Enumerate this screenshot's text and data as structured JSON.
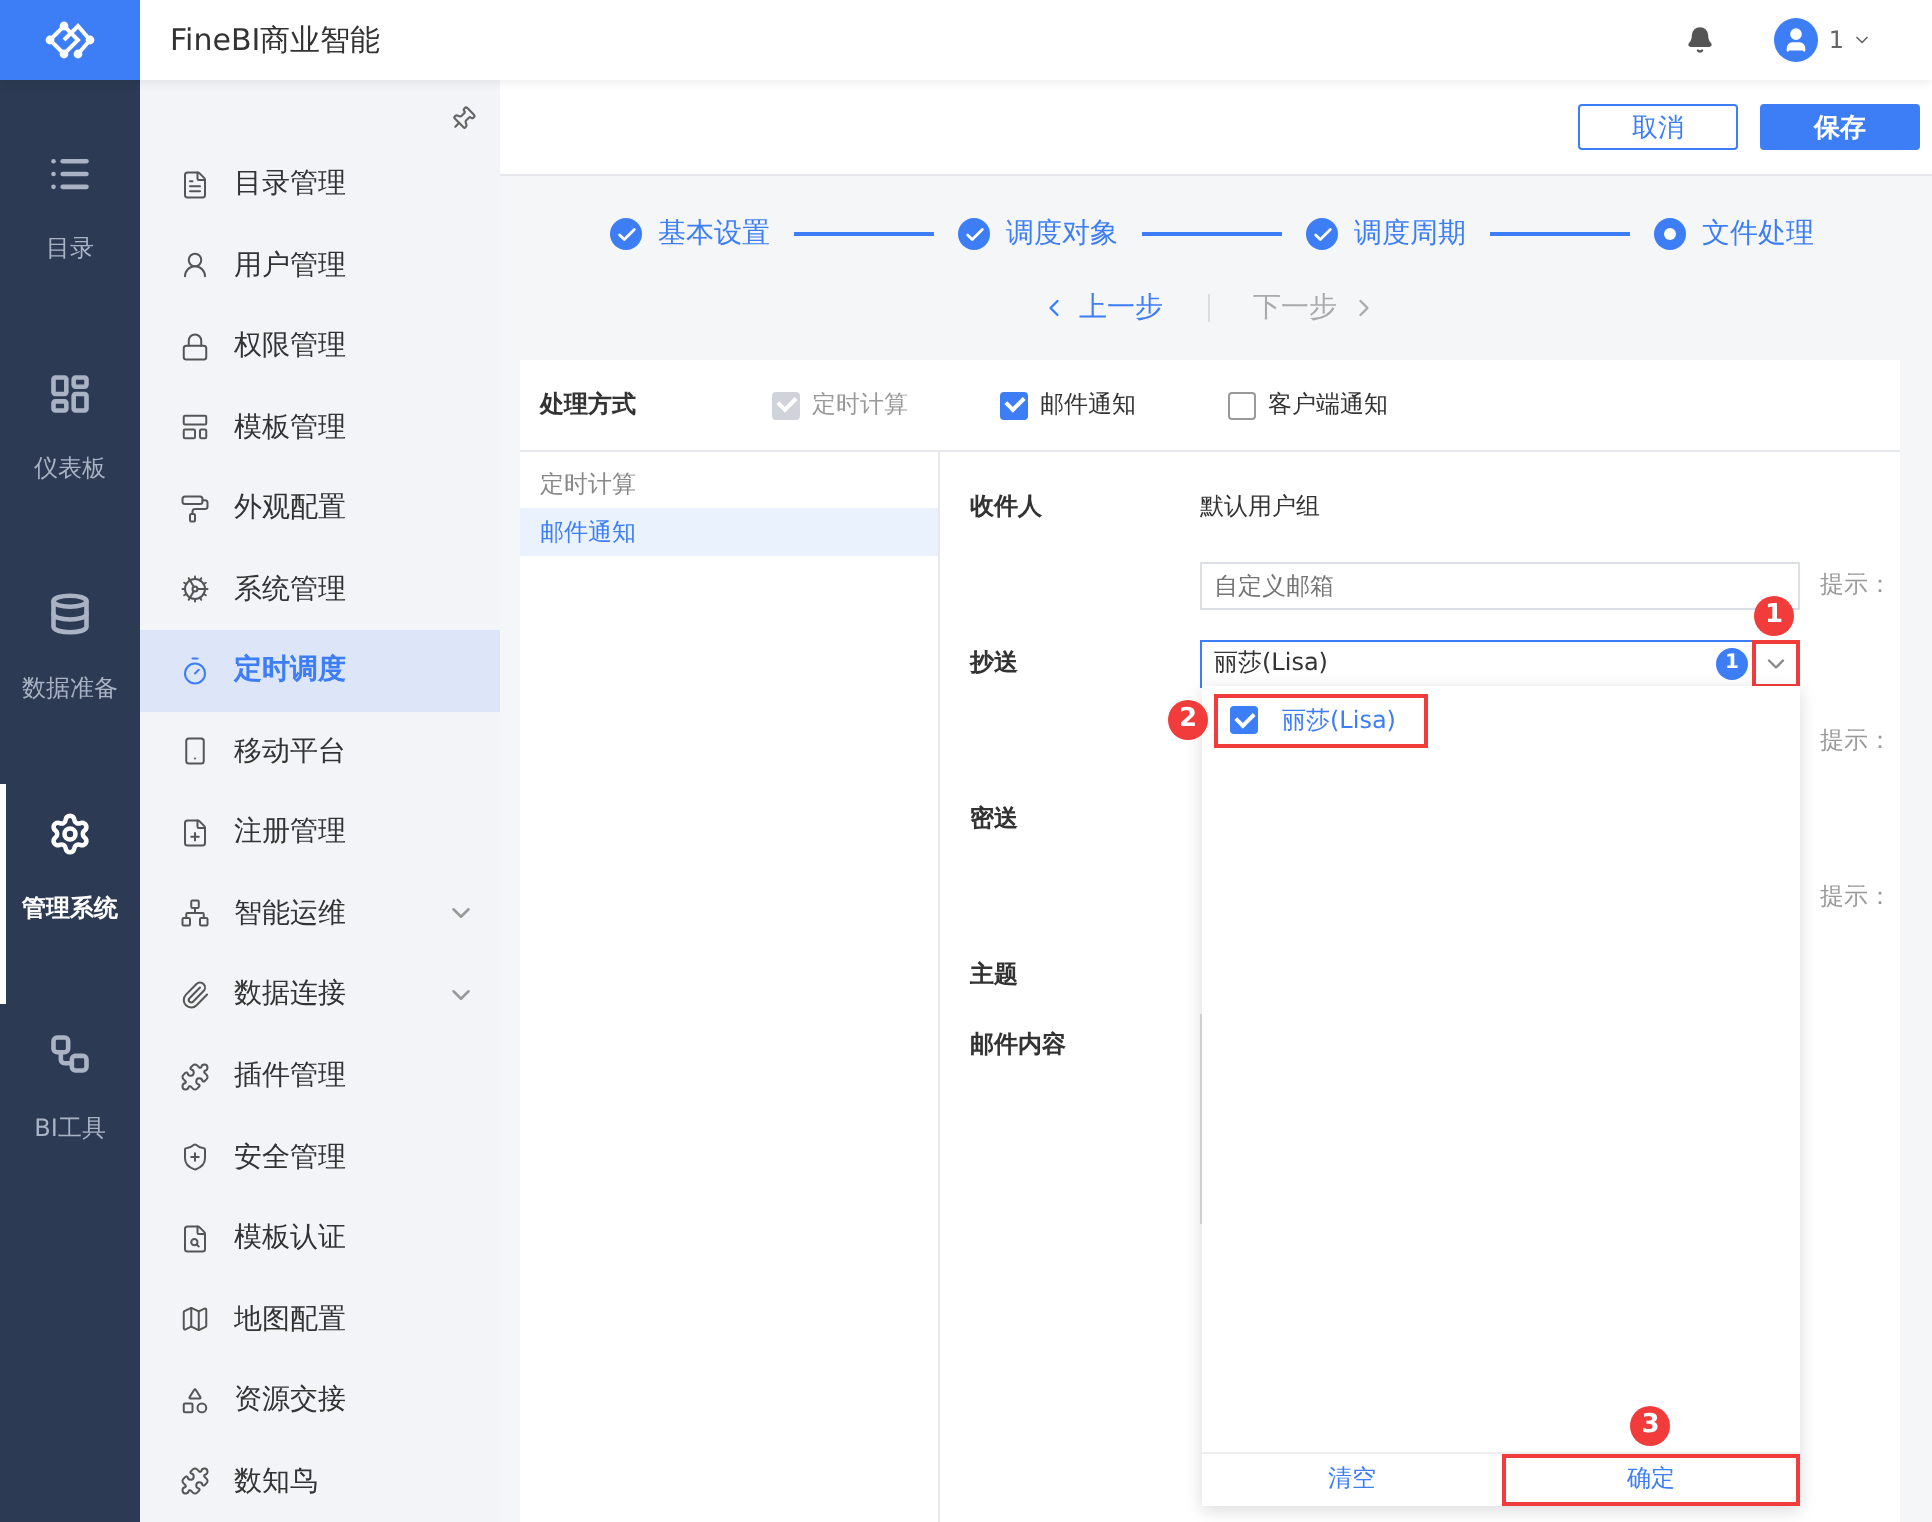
{
  "header": {
    "title": "FineBI商业智能",
    "user": "1"
  },
  "nav_rail": [
    {
      "label": "目录",
      "selected": false
    },
    {
      "label": "仪表板",
      "selected": false
    },
    {
      "label": "数据准备",
      "selected": false
    },
    {
      "label": "管理系统",
      "selected": true
    },
    {
      "label": "BI工具",
      "selected": false
    }
  ],
  "menu": [
    {
      "label": "目录管理",
      "selected": false,
      "expandable": false
    },
    {
      "label": "用户管理",
      "selected": false,
      "expandable": false
    },
    {
      "label": "权限管理",
      "selected": false,
      "expandable": false
    },
    {
      "label": "模板管理",
      "selected": false,
      "expandable": false
    },
    {
      "label": "外观配置",
      "selected": false,
      "expandable": false
    },
    {
      "label": "系统管理",
      "selected": false,
      "expandable": false
    },
    {
      "label": "定时调度",
      "selected": true,
      "expandable": false
    },
    {
      "label": "移动平台",
      "selected": false,
      "expandable": false
    },
    {
      "label": "注册管理",
      "selected": false,
      "expandable": false
    },
    {
      "label": "智能运维",
      "selected": false,
      "expandable": true
    },
    {
      "label": "数据连接",
      "selected": false,
      "expandable": true
    },
    {
      "label": "插件管理",
      "selected": false,
      "expandable": false
    },
    {
      "label": "安全管理",
      "selected": false,
      "expandable": false
    },
    {
      "label": "模板认证",
      "selected": false,
      "expandable": false
    },
    {
      "label": "地图配置",
      "selected": false,
      "expandable": false
    },
    {
      "label": "资源交接",
      "selected": false,
      "expandable": false
    },
    {
      "label": "数知鸟",
      "selected": false,
      "expandable": false
    }
  ],
  "toolbar": [
    {
      "label": "取消",
      "kind": "secondary"
    },
    {
      "label": "保存",
      "kind": "primary"
    }
  ],
  "steps": [
    {
      "label": "基本设置",
      "done": true
    },
    {
      "label": "调度对象",
      "done": true
    },
    {
      "label": "调度周期",
      "done": true
    },
    {
      "label": "文件处理",
      "done": false
    }
  ],
  "step_nav": [
    {
      "label": "上一步",
      "kind": "prev",
      "disabled": false
    },
    {
      "label": "下一步",
      "kind": "next",
      "disabled": true
    }
  ],
  "processing": {
    "label": "处理方式",
    "options": [
      {
        "label": "定时计算",
        "checked": true,
        "disabled": true
      },
      {
        "label": "邮件通知",
        "checked": true,
        "disabled": false
      },
      {
        "label": "客户端通知",
        "checked": false,
        "disabled": false
      }
    ]
  },
  "sections": [
    {
      "label": "定时计算",
      "selected": false
    },
    {
      "label": "邮件通知",
      "selected": true
    }
  ],
  "form": [
    {
      "kind": "text",
      "label": "收件人",
      "value": "默认用户组"
    },
    {
      "kind": "input",
      "placeholder": "自定义邮箱",
      "hint": "提示："
    },
    {
      "kind": "select",
      "label": "抄送",
      "value": "丽莎(Lisa)",
      "count": "1",
      "expanded": true,
      "highlighted": true,
      "callout": "1"
    },
    {
      "kind": "hint",
      "hint": "提示："
    },
    {
      "kind": "label",
      "label": "密送"
    },
    {
      "kind": "hint",
      "hint": "提示："
    },
    {
      "kind": "label",
      "label": "主题"
    },
    {
      "kind": "editor",
      "label": "邮件内容"
    }
  ],
  "dropdown": {
    "options": [
      {
        "label": "丽莎(Lisa)",
        "checked": true,
        "highlighted": true,
        "callout": "2"
      }
    ],
    "buttons": [
      {
        "label": "清空",
        "highlighted": false
      },
      {
        "label": "确定",
        "highlighted": true,
        "callout": "3"
      }
    ]
  }
}
